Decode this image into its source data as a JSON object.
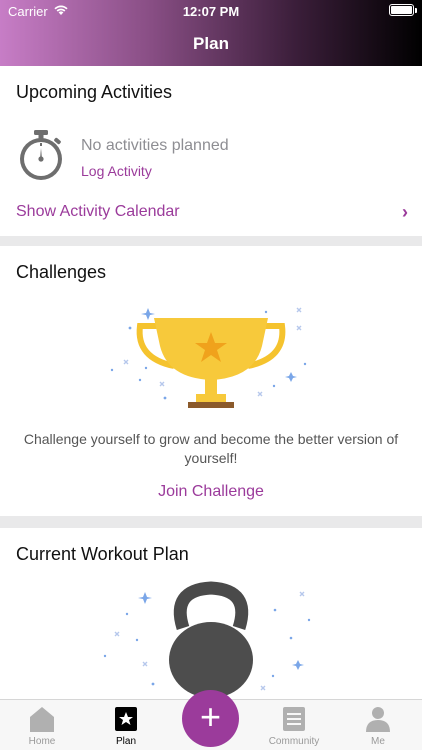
{
  "status_bar": {
    "carrier": "Carrier",
    "time": "12:07 PM"
  },
  "nav": {
    "title": "Plan"
  },
  "upcoming": {
    "title": "Upcoming Activities",
    "empty_text": "No activities planned",
    "log_link": "Log Activity",
    "calendar_link": "Show Activity Calendar",
    "chevron": "›"
  },
  "challenges": {
    "title": "Challenges",
    "description": "Challenge yourself to grow and become the better version of yourself!",
    "join_link": "Join Challenge"
  },
  "workout": {
    "title": "Current Workout Plan"
  },
  "tabs": [
    {
      "label": "Home",
      "icon": "home-icon"
    },
    {
      "label": "Plan",
      "icon": "star-square-icon"
    },
    {
      "label": "Community",
      "icon": "community-icon"
    },
    {
      "label": "Me",
      "icon": "person-icon"
    }
  ],
  "fab": {
    "symbol": "+",
    "icon": "plus-icon"
  },
  "colors": {
    "accent": "#9b3b9b",
    "trophy": "#f4c430",
    "kettlebell": "#4d4d4d"
  }
}
